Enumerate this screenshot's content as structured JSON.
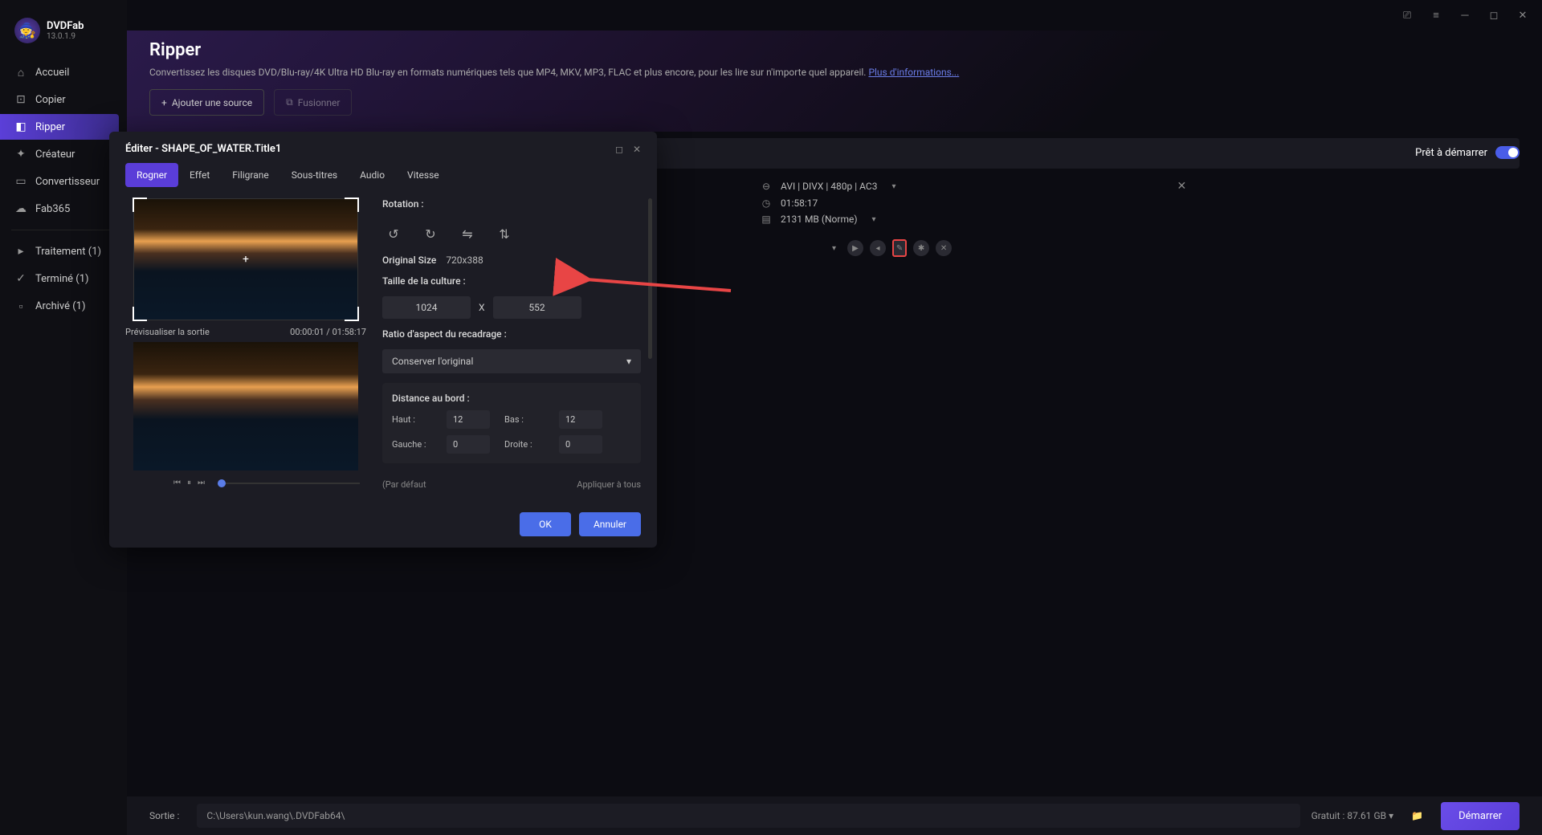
{
  "app": {
    "name": "DVDFab",
    "version": "13.0.1.9"
  },
  "nav": {
    "items": [
      {
        "label": "Accueil",
        "icon": "⌂"
      },
      {
        "label": "Copier",
        "icon": "⊡"
      },
      {
        "label": "Ripper",
        "icon": "◧"
      },
      {
        "label": "Créateur",
        "icon": "✦"
      },
      {
        "label": "Convertisseur",
        "icon": "▭"
      },
      {
        "label": "Fab365",
        "icon": "☁"
      }
    ],
    "status": [
      {
        "label": "Traitement (1)",
        "icon": "▸"
      },
      {
        "label": "Terminé (1)",
        "icon": "✓"
      },
      {
        "label": "Archivé (1)",
        "icon": "▫"
      }
    ]
  },
  "header": {
    "title": "Ripper",
    "desc": "Convertissez les disques DVD/Blu-ray/4K Ultra HD Blu-ray en formats numériques tels que MP4, MKV, MP3, FLAC et plus encore, pour les lire sur n'importe quel appareil. ",
    "link": "Plus d'informations...",
    "add_src": "Ajouter une source",
    "merge": "Fusionner"
  },
  "content": {
    "ready": "Prêt à démarrer",
    "info": {
      "format": "AVI | DIVX | 480p | AC3",
      "duration": "01:58:17",
      "size": "2131 MB (Norme)"
    }
  },
  "modal": {
    "title": "Éditer - SHAPE_OF_WATER.Title1",
    "tabs": [
      "Rogner",
      "Effet",
      "Filigrane",
      "Sous-titres",
      "Audio",
      "Vitesse"
    ],
    "preview_label": "Prévisualiser la sortie",
    "time": "00:00:01 / 01:58:17",
    "rotation_label": "Rotation :",
    "orig_size_label": "Original Size",
    "orig_size": "720x388",
    "crop_size_label": "Taille de la culture :",
    "crop_w": "1024",
    "crop_h": "552",
    "x": "X",
    "aspect_label": "Ratio d'aspect du recadrage :",
    "aspect_val": "Conserver l'original",
    "edge_label": "Distance au bord :",
    "edge": {
      "haut_l": "Haut :",
      "haut": "12",
      "bas_l": "Bas :",
      "bas": "12",
      "gauche_l": "Gauche :",
      "gauche": "0",
      "droite_l": "Droite :",
      "droite": "0"
    },
    "default": "(Par défaut",
    "apply_all": "Appliquer à tous",
    "ok": "OK",
    "cancel": "Annuler"
  },
  "footer": {
    "out_label": "Sortie :",
    "out_path": "C:\\Users\\kun.wang\\.DVDFab64\\",
    "free": "Gratuit : 87.61 GB ▾",
    "start": "Démarrer"
  }
}
